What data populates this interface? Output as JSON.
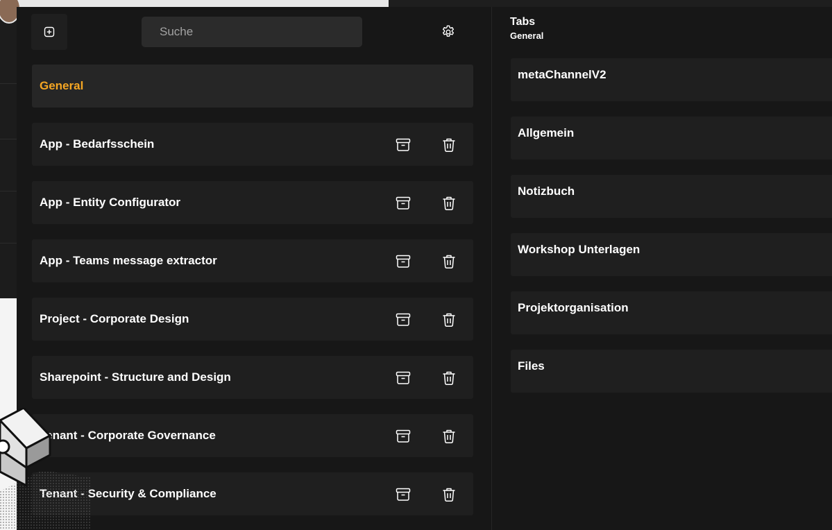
{
  "header": {
    "search_placeholder": "Suche",
    "add_icon": "add-square-icon",
    "settings_icon": "gear-icon"
  },
  "colors": {
    "accent": "#f5a623",
    "panel_bg": "#171717",
    "item_bg": "#1f1f1f",
    "text": "#ffffff"
  },
  "channels": [
    {
      "label": "General",
      "active": true
    },
    {
      "label": "App - Bedarfsschein"
    },
    {
      "label": "App - Entity Configurator"
    },
    {
      "label": "App - Teams message extractor"
    },
    {
      "label": "Project - Corporate Design"
    },
    {
      "label": "Sharepoint - Structure and Design"
    },
    {
      "label": "Tenant - Corporate Governance"
    },
    {
      "label": "Tenant - Security & Compliance"
    }
  ],
  "tabs_panel": {
    "title": "Tabs",
    "subtitle": "General",
    "tabs": [
      {
        "label": "metaChannelV2"
      },
      {
        "label": "Allgemein"
      },
      {
        "label": "Notizbuch"
      },
      {
        "label": "Workshop Unterlagen"
      },
      {
        "label": "Projektorganisation"
      },
      {
        "label": "Files"
      }
    ]
  }
}
